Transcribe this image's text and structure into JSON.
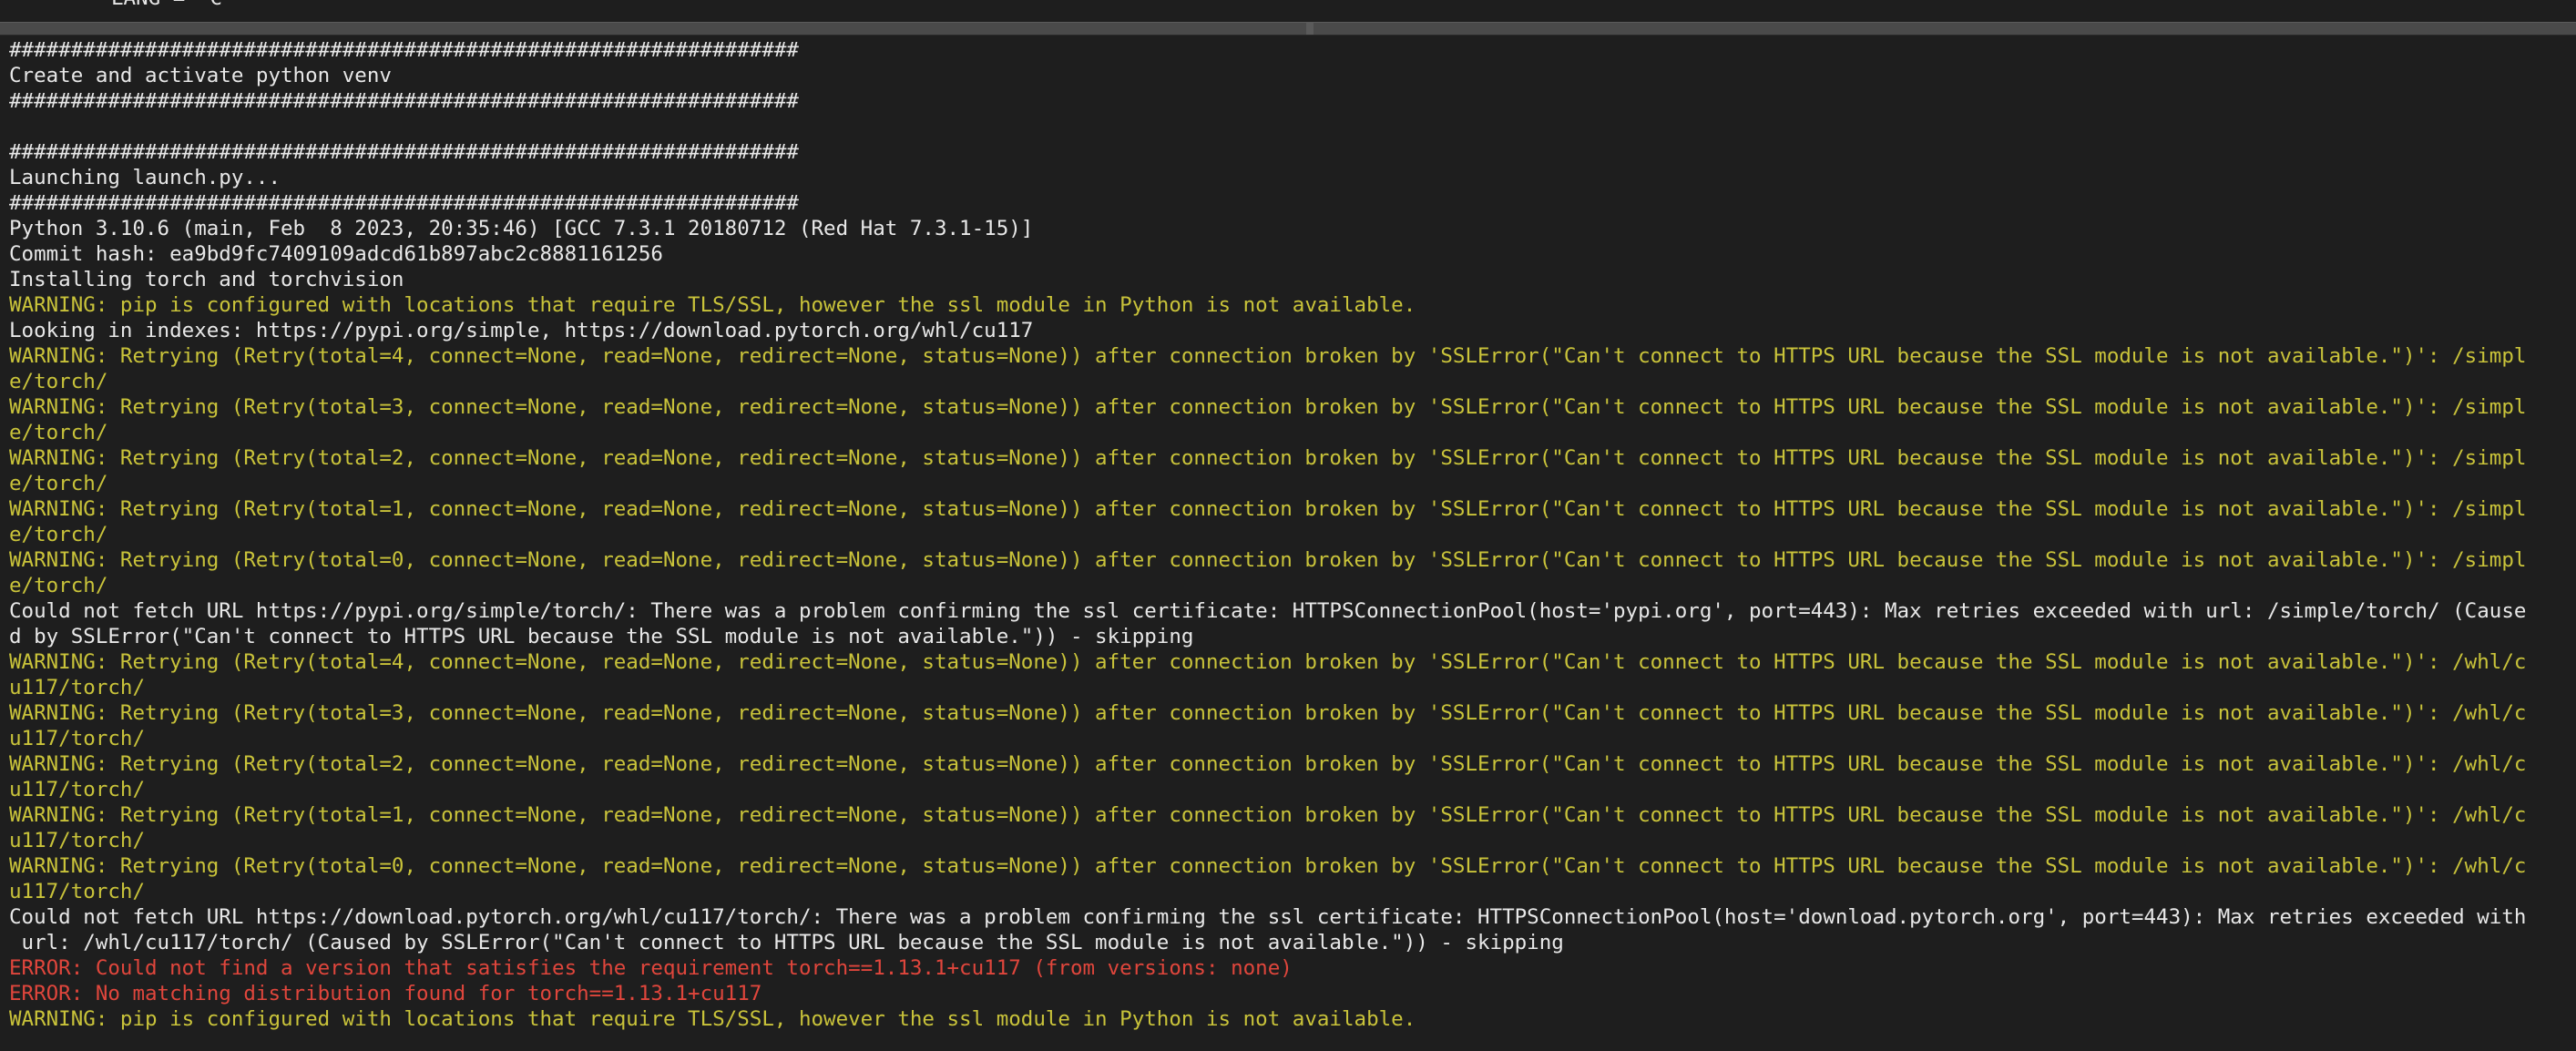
{
  "window": {
    "top_line": "LANG = \"C\""
  },
  "terminal": {
    "lines": [
      {
        "kind": "normal",
        "text": "################################################################"
      },
      {
        "kind": "normal",
        "text": "Create and activate python venv"
      },
      {
        "kind": "normal",
        "text": "################################################################"
      },
      {
        "kind": "blank",
        "text": " "
      },
      {
        "kind": "normal",
        "text": "################################################################"
      },
      {
        "kind": "normal",
        "text": "Launching launch.py..."
      },
      {
        "kind": "normal",
        "text": "################################################################"
      },
      {
        "kind": "normal",
        "text": "Python 3.10.6 (main, Feb  8 2023, 20:35:46) [GCC 7.3.1 20180712 (Red Hat 7.3.1-15)]"
      },
      {
        "kind": "normal",
        "text": "Commit hash: ea9bd9fc7409109adcd61b897abc2c8881161256"
      },
      {
        "kind": "normal",
        "text": "Installing torch and torchvision"
      },
      {
        "kind": "warning",
        "text": "WARNING: pip is configured with locations that require TLS/SSL, however the ssl module in Python is not available."
      },
      {
        "kind": "normal",
        "text": "Looking in indexes: https://pypi.org/simple, https://download.pytorch.org/whl/cu117"
      },
      {
        "kind": "warning",
        "text": "WARNING: Retrying (Retry(total=4, connect=None, read=None, redirect=None, status=None)) after connection broken by 'SSLError(\"Can't connect to HTTPS URL because the SSL module is not available.\")': /simpl"
      },
      {
        "kind": "warning",
        "text": "e/torch/"
      },
      {
        "kind": "warning",
        "text": "WARNING: Retrying (Retry(total=3, connect=None, read=None, redirect=None, status=None)) after connection broken by 'SSLError(\"Can't connect to HTTPS URL because the SSL module is not available.\")': /simpl"
      },
      {
        "kind": "warning",
        "text": "e/torch/"
      },
      {
        "kind": "warning",
        "text": "WARNING: Retrying (Retry(total=2, connect=None, read=None, redirect=None, status=None)) after connection broken by 'SSLError(\"Can't connect to HTTPS URL because the SSL module is not available.\")': /simpl"
      },
      {
        "kind": "warning",
        "text": "e/torch/"
      },
      {
        "kind": "warning",
        "text": "WARNING: Retrying (Retry(total=1, connect=None, read=None, redirect=None, status=None)) after connection broken by 'SSLError(\"Can't connect to HTTPS URL because the SSL module is not available.\")': /simpl"
      },
      {
        "kind": "warning",
        "text": "e/torch/"
      },
      {
        "kind": "warning",
        "text": "WARNING: Retrying (Retry(total=0, connect=None, read=None, redirect=None, status=None)) after connection broken by 'SSLError(\"Can't connect to HTTPS URL because the SSL module is not available.\")': /simpl"
      },
      {
        "kind": "warning",
        "text": "e/torch/"
      },
      {
        "kind": "normal",
        "text": "Could not fetch URL https://pypi.org/simple/torch/: There was a problem confirming the ssl certificate: HTTPSConnectionPool(host='pypi.org', port=443): Max retries exceeded with url: /simple/torch/ (Cause"
      },
      {
        "kind": "normal",
        "text": "d by SSLError(\"Can't connect to HTTPS URL because the SSL module is not available.\")) - skipping"
      },
      {
        "kind": "warning",
        "text": "WARNING: Retrying (Retry(total=4, connect=None, read=None, redirect=None, status=None)) after connection broken by 'SSLError(\"Can't connect to HTTPS URL because the SSL module is not available.\")': /whl/c"
      },
      {
        "kind": "warning",
        "text": "u117/torch/"
      },
      {
        "kind": "warning",
        "text": "WARNING: Retrying (Retry(total=3, connect=None, read=None, redirect=None, status=None)) after connection broken by 'SSLError(\"Can't connect to HTTPS URL because the SSL module is not available.\")': /whl/c"
      },
      {
        "kind": "warning",
        "text": "u117/torch/"
      },
      {
        "kind": "warning",
        "text": "WARNING: Retrying (Retry(total=2, connect=None, read=None, redirect=None, status=None)) after connection broken by 'SSLError(\"Can't connect to HTTPS URL because the SSL module is not available.\")': /whl/c"
      },
      {
        "kind": "warning",
        "text": "u117/torch/"
      },
      {
        "kind": "warning",
        "text": "WARNING: Retrying (Retry(total=1, connect=None, read=None, redirect=None, status=None)) after connection broken by 'SSLError(\"Can't connect to HTTPS URL because the SSL module is not available.\")': /whl/c"
      },
      {
        "kind": "warning",
        "text": "u117/torch/"
      },
      {
        "kind": "warning",
        "text": "WARNING: Retrying (Retry(total=0, connect=None, read=None, redirect=None, status=None)) after connection broken by 'SSLError(\"Can't connect to HTTPS URL because the SSL module is not available.\")': /whl/c"
      },
      {
        "kind": "warning",
        "text": "u117/torch/"
      },
      {
        "kind": "normal",
        "text": "Could not fetch URL https://download.pytorch.org/whl/cu117/torch/: There was a problem confirming the ssl certificate: HTTPSConnectionPool(host='download.pytorch.org', port=443): Max retries exceeded with"
      },
      {
        "kind": "normal",
        "text": " url: /whl/cu117/torch/ (Caused by SSLError(\"Can't connect to HTTPS URL because the SSL module is not available.\")) - skipping"
      },
      {
        "kind": "error",
        "text": "ERROR: Could not find a version that satisfies the requirement torch==1.13.1+cu117 (from versions: none)"
      },
      {
        "kind": "error",
        "text": "ERROR: No matching distribution found for torch==1.13.1+cu117"
      },
      {
        "kind": "warning",
        "text": "WARNING: pip is configured with locations that require TLS/SSL, however the ssl module in Python is not available."
      }
    ]
  },
  "colors": {
    "background": "#1e1e1e",
    "normal": "#e8e8e8",
    "warning": "#c9c33a",
    "error": "#e0463c"
  }
}
